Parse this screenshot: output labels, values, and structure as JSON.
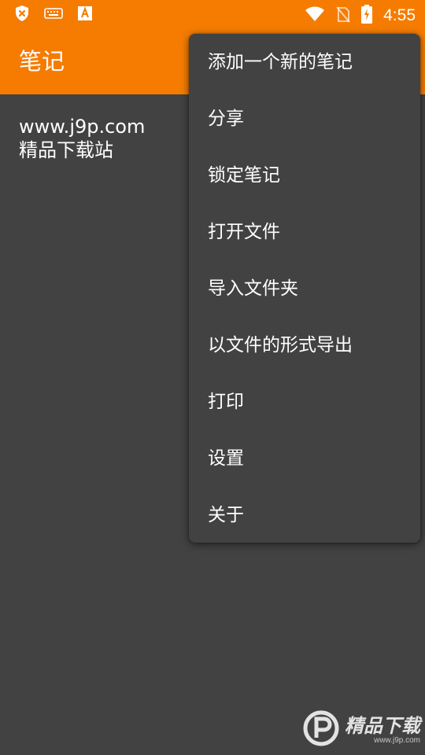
{
  "status_bar": {
    "time": "4:55",
    "icons": [
      "shield-x-icon",
      "keyboard-icon",
      "font-a-icon",
      "wifi-icon",
      "no-sim-icon",
      "battery-charging-icon"
    ],
    "color": "#f57c00"
  },
  "app_bar": {
    "title": "笔记"
  },
  "content": {
    "line1": "www.j9p.com",
    "line2": "精品下载站"
  },
  "menu": {
    "items": [
      {
        "label": "添加一个新的笔记"
      },
      {
        "label": "分享"
      },
      {
        "label": "锁定笔记"
      },
      {
        "label": "打开文件"
      },
      {
        "label": "导入文件夹"
      },
      {
        "label": "以文件的形式导出"
      },
      {
        "label": "打印"
      },
      {
        "label": "设置"
      },
      {
        "label": "关于"
      }
    ]
  },
  "watermark": {
    "title": "精品下载",
    "url": "www.j9p.com"
  },
  "colors": {
    "accent": "#f57c00",
    "background": "#424242",
    "text": "#ffffff"
  }
}
